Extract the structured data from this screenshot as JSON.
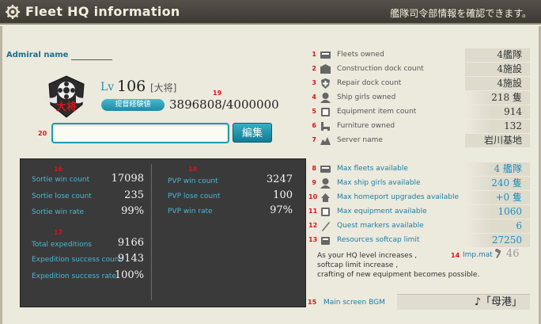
{
  "header": {
    "title": "Fleet HQ information",
    "subtitle": "艦隊司令部情報を確認できます。",
    "icon": "gear-icon"
  },
  "admiral": {
    "name_label": "Admiral name",
    "lv_label": "Lv",
    "level": "106",
    "rank": "[大将]",
    "emblem_text": "大将",
    "exp_badge": "提督経験値",
    "exp": "3896808/4000000"
  },
  "comment": {
    "value": "",
    "edit_label": "編集"
  },
  "annotations": {
    "n14": "14",
    "n16": "16",
    "n17": "17",
    "n18": "18",
    "n19": "19",
    "n20": "20",
    "n15": "15"
  },
  "stats": {
    "sortie_win_label": "Sortie win count",
    "sortie_win": "17098",
    "sortie_lose_label": "Sortie lose count",
    "sortie_lose": "235",
    "sortie_rate_label": "Sortie win rate",
    "sortie_rate": "99%",
    "pvp_win_label": "PVP win count",
    "pvp_win": "3247",
    "pvp_lose_label": "PVP lose count",
    "pvp_lose": "100",
    "pvp_rate_label": "PVP win rate",
    "pvp_rate": "97%",
    "exp_total_label": "Total expeditions",
    "exp_total": "9166",
    "exp_success_label": "Expedition success count",
    "exp_success": "9143",
    "exp_rate_label": "Expedition success rate",
    "exp_rate": "100%"
  },
  "hq_rows": [
    {
      "num": "1",
      "label": "Fleets owned",
      "value": "4艦隊",
      "icon": "fleet-icon"
    },
    {
      "num": "2",
      "label": "Construction dock count",
      "value": "4施設",
      "icon": "construction-dock-icon"
    },
    {
      "num": "3",
      "label": "Repair dock count",
      "value": "4施設",
      "icon": "repair-dock-icon"
    },
    {
      "num": "4",
      "label": "Ship girls owned",
      "value": "218 隻",
      "icon": "ship-girl-icon"
    },
    {
      "num": "5",
      "label": "Equipment item count",
      "value": "914",
      "icon": "equipment-icon"
    },
    {
      "num": "6",
      "label": "Furniture owned",
      "value": "132",
      "icon": "furniture-icon"
    },
    {
      "num": "7",
      "label": "Server name",
      "value": "岩川基地",
      "icon": "server-icon"
    },
    {
      "num": "8",
      "label": "Max fleets available",
      "value": "4 艦隊",
      "icon": "fleet-icon"
    },
    {
      "num": "9",
      "label": "Max ship girls available",
      "value": "240 隻",
      "icon": "ship-girl-icon"
    },
    {
      "num": "10",
      "label": "Max homeport upgrades available",
      "value": "+0 隻",
      "icon": "homeport-icon"
    },
    {
      "num": "11",
      "label": "Max equipment available",
      "value": "1060",
      "icon": "equipment-icon"
    },
    {
      "num": "12",
      "label": "Quest markers available",
      "value": "6",
      "icon": "quest-marker-icon"
    },
    {
      "num": "13",
      "label": "Resources softcap limit",
      "value": "27250",
      "icon": "resources-icon"
    }
  ],
  "note": {
    "line1": "As your HQ level increases ,",
    "line2": "softcap limit increase ,",
    "line3": "crafting of new equipment becomes possible."
  },
  "imp_mat": {
    "label": "Imp.mat",
    "value": "46",
    "icon": "hammer-icon"
  },
  "bgm": {
    "label": "Main screen BGM",
    "value": "♪「母港」"
  }
}
